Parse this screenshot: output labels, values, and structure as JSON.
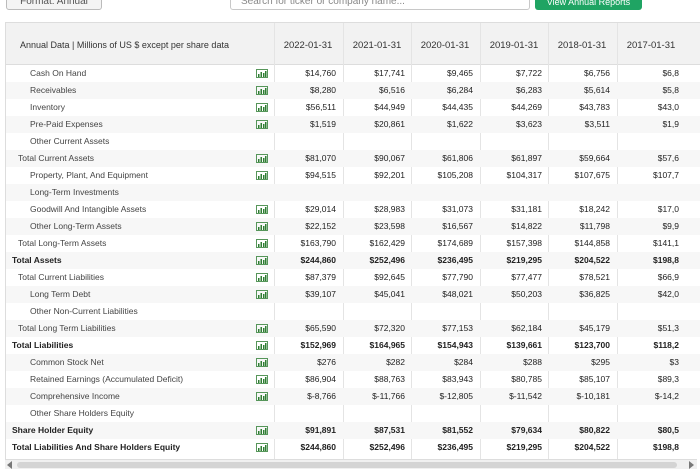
{
  "toolbar": {
    "format_label": "Format: Annual",
    "search_placeholder": "Search for ticker or company name...",
    "reports_label": "View Annual Reports"
  },
  "table": {
    "header_label": "Annual Data | Millions of US $ except per share data",
    "columns": [
      "2022-01-31",
      "2021-01-31",
      "2020-01-31",
      "2019-01-31",
      "2018-01-31",
      "2017-01-31"
    ],
    "rows": [
      {
        "label": "Cash On Hand",
        "indent": 2,
        "bold": false,
        "chart": true,
        "values": [
          "$14,760",
          "$17,741",
          "$9,465",
          "$7,722",
          "$6,756",
          "$6,8"
        ]
      },
      {
        "label": "Receivables",
        "indent": 2,
        "bold": false,
        "chart": true,
        "values": [
          "$8,280",
          "$6,516",
          "$6,284",
          "$6,283",
          "$5,614",
          "$5,8"
        ]
      },
      {
        "label": "Inventory",
        "indent": 2,
        "bold": false,
        "chart": true,
        "values": [
          "$56,511",
          "$44,949",
          "$44,435",
          "$44,269",
          "$43,783",
          "$43,0"
        ]
      },
      {
        "label": "Pre-Paid Expenses",
        "indent": 2,
        "bold": false,
        "chart": true,
        "values": [
          "$1,519",
          "$20,861",
          "$1,622",
          "$3,623",
          "$3,511",
          "$1,9"
        ]
      },
      {
        "label": "Other Current Assets",
        "indent": 2,
        "bold": false,
        "chart": false,
        "values": [
          "",
          "",
          "",
          "",
          "",
          ""
        ]
      },
      {
        "label": "Total Current Assets",
        "indent": 1,
        "bold": false,
        "chart": true,
        "values": [
          "$81,070",
          "$90,067",
          "$61,806",
          "$61,897",
          "$59,664",
          "$57,6"
        ]
      },
      {
        "label": "Property, Plant, And Equipment",
        "indent": 2,
        "bold": false,
        "chart": true,
        "values": [
          "$94,515",
          "$92,201",
          "$105,208",
          "$104,317",
          "$107,675",
          "$107,7"
        ]
      },
      {
        "label": "Long-Term Investments",
        "indent": 2,
        "bold": false,
        "chart": false,
        "values": [
          "",
          "",
          "",
          "",
          "",
          ""
        ]
      },
      {
        "label": "Goodwill And Intangible Assets",
        "indent": 2,
        "bold": false,
        "chart": true,
        "values": [
          "$29,014",
          "$28,983",
          "$31,073",
          "$31,181",
          "$18,242",
          "$17,0"
        ]
      },
      {
        "label": "Other Long-Term Assets",
        "indent": 2,
        "bold": false,
        "chart": true,
        "values": [
          "$22,152",
          "$23,598",
          "$16,567",
          "$14,822",
          "$11,798",
          "$9,9"
        ]
      },
      {
        "label": "Total Long-Term Assets",
        "indent": 1,
        "bold": false,
        "chart": true,
        "values": [
          "$163,790",
          "$162,429",
          "$174,689",
          "$157,398",
          "$144,858",
          "$141,1"
        ]
      },
      {
        "label": "Total Assets",
        "indent": 0,
        "bold": true,
        "chart": true,
        "values": [
          "$244,860",
          "$252,496",
          "$236,495",
          "$219,295",
          "$204,522",
          "$198,8"
        ]
      },
      {
        "label": "Total Current Liabilities",
        "indent": 1,
        "bold": false,
        "chart": true,
        "values": [
          "$87,379",
          "$92,645",
          "$77,790",
          "$77,477",
          "$78,521",
          "$66,9"
        ]
      },
      {
        "label": "Long Term Debt",
        "indent": 2,
        "bold": false,
        "chart": true,
        "values": [
          "$39,107",
          "$45,041",
          "$48,021",
          "$50,203",
          "$36,825",
          "$42,0"
        ]
      },
      {
        "label": "Other Non-Current Liabilities",
        "indent": 2,
        "bold": false,
        "chart": false,
        "values": [
          "",
          "",
          "",
          "",
          "",
          ""
        ]
      },
      {
        "label": "Total Long Term Liabilities",
        "indent": 1,
        "bold": false,
        "chart": true,
        "values": [
          "$65,590",
          "$72,320",
          "$77,153",
          "$62,184",
          "$45,179",
          "$51,3"
        ]
      },
      {
        "label": "Total Liabilities",
        "indent": 0,
        "bold": true,
        "chart": true,
        "values": [
          "$152,969",
          "$164,965",
          "$154,943",
          "$139,661",
          "$123,700",
          "$118,2"
        ]
      },
      {
        "label": "Common Stock Net",
        "indent": 2,
        "bold": false,
        "chart": true,
        "values": [
          "$276",
          "$282",
          "$284",
          "$288",
          "$295",
          "$3"
        ]
      },
      {
        "label": "Retained Earnings (Accumulated Deficit)",
        "indent": 2,
        "bold": false,
        "chart": true,
        "values": [
          "$86,904",
          "$88,763",
          "$83,943",
          "$80,785",
          "$85,107",
          "$89,3"
        ]
      },
      {
        "label": "Comprehensive Income",
        "indent": 2,
        "bold": false,
        "chart": true,
        "values": [
          "$-8,766",
          "$-11,766",
          "$-12,805",
          "$-11,542",
          "$-10,181",
          "$-14,2"
        ]
      },
      {
        "label": "Other Share Holders Equity",
        "indent": 2,
        "bold": false,
        "chart": false,
        "values": [
          "",
          "",
          "",
          "",
          "",
          ""
        ]
      },
      {
        "label": "Share Holder Equity",
        "indent": 0,
        "bold": true,
        "chart": true,
        "values": [
          "$91,891",
          "$87,531",
          "$81,552",
          "$79,634",
          "$80,822",
          "$80,5"
        ]
      },
      {
        "label": "Total Liabilities And Share Holders Equity",
        "indent": 0,
        "bold": true,
        "chart": true,
        "values": [
          "$244,860",
          "$252,496",
          "$236,495",
          "$219,295",
          "$204,522",
          "$198,8"
        ]
      }
    ]
  },
  "colors": {
    "accent_green": "#1fa463",
    "chart_icon": "#2e7d32"
  },
  "icons": {
    "chart": "bar-chart-icon"
  }
}
